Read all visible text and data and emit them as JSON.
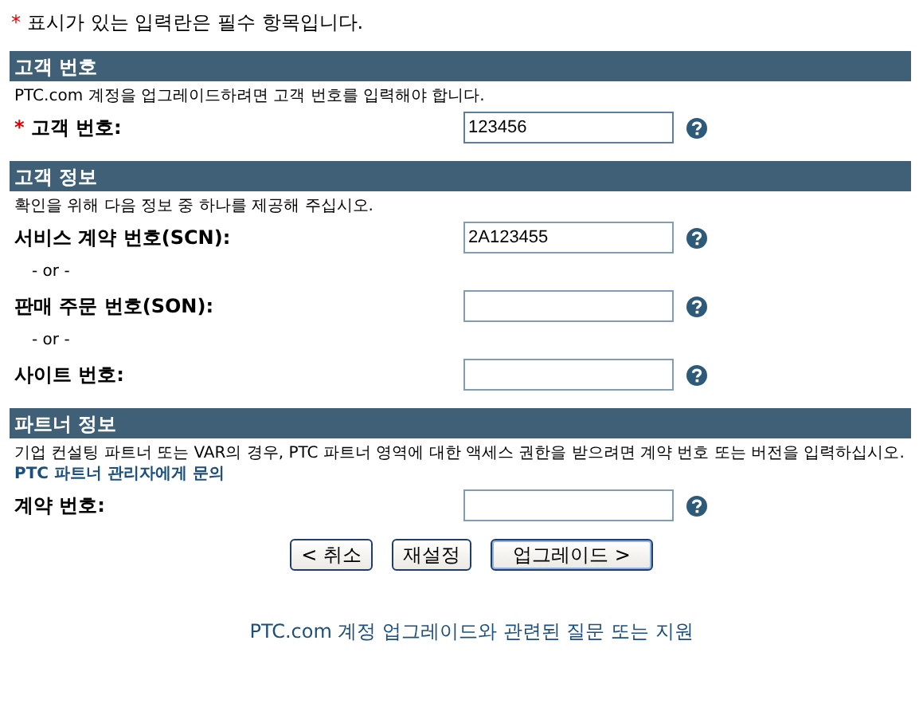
{
  "required_note": {
    "mark": "*",
    "text": "표시가 있는 입력란은 필수 항목입니다."
  },
  "sections": [
    {
      "title": "고객 번호",
      "description": "PTC.com 계정을 업그레이드하려면 고객 번호를 입력해야 합니다.",
      "rows": [
        {
          "kind": "field",
          "label": "고객 번호:",
          "required": true,
          "required_mark": "*",
          "value": "123456",
          "focused": true
        }
      ]
    },
    {
      "title": "고객 정보",
      "description": "확인을 위해 다음 정보 중 하나를 제공해 주십시오.",
      "rows": [
        {
          "kind": "field",
          "label": "서비스 계약 번호(SCN):",
          "required": false,
          "value": "2A123455",
          "focused": false
        },
        {
          "kind": "or",
          "text": "- or -"
        },
        {
          "kind": "field",
          "label": "판매 주문 번호(SON):",
          "required": false,
          "focused": false
        },
        {
          "kind": "or",
          "text": "- or -"
        },
        {
          "kind": "field",
          "label": "사이트 번호:",
          "required": false,
          "focused": false
        }
      ]
    },
    {
      "title": "파트너 정보",
      "description": "기업 컨설팅 파트너 또는 VAR의 경우, PTC 파트너 영역에 대한 액세스 권한을 받으려면 계약 번호 또는 버전을 입력하십시오.",
      "link": "PTC 파트너 관리자에게 문의",
      "rows": [
        {
          "kind": "field",
          "label": "계약 번호:",
          "required": false,
          "focused": false
        }
      ]
    }
  ],
  "buttons": [
    {
      "label": "< 취소",
      "primary": false
    },
    {
      "label": "재설정",
      "primary": false
    },
    {
      "label": "업그레이드 >",
      "primary": true
    }
  ],
  "footer_link": "PTC.com 계정 업그레이드와 관련된 질문 또는 지원"
}
